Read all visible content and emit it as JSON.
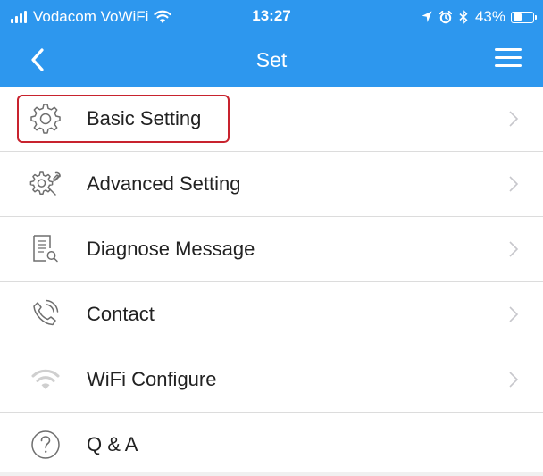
{
  "status_bar": {
    "carrier": "Vodacom VoWiFi",
    "time": "13:27",
    "battery_percent": "43%",
    "battery_level": 0.43,
    "icons": [
      "signal-icon",
      "wifi-icon",
      "location-icon",
      "alarm-icon",
      "bluetooth-icon",
      "battery-icon"
    ]
  },
  "nav": {
    "title": "Set",
    "back_icon": "back-chevron-icon",
    "menu_icon": "hamburger-menu-icon"
  },
  "menu": {
    "items": [
      {
        "label": "Basic Setting",
        "icon": "gear-icon",
        "highlighted": true
      },
      {
        "label": "Advanced Setting",
        "icon": "gear-wrench-icon"
      },
      {
        "label": "Diagnose Message",
        "icon": "document-search-icon"
      },
      {
        "label": "Contact",
        "icon": "phone-icon"
      },
      {
        "label": "WiFi Configure",
        "icon": "wifi-icon"
      },
      {
        "label": "Q & A",
        "icon": "question-icon"
      }
    ]
  },
  "colors": {
    "header_bg": "#2d97ee",
    "highlight_border": "#c8232e",
    "icon_gray": "#8a8a8a",
    "chevron_gray": "#c7c7cc"
  }
}
